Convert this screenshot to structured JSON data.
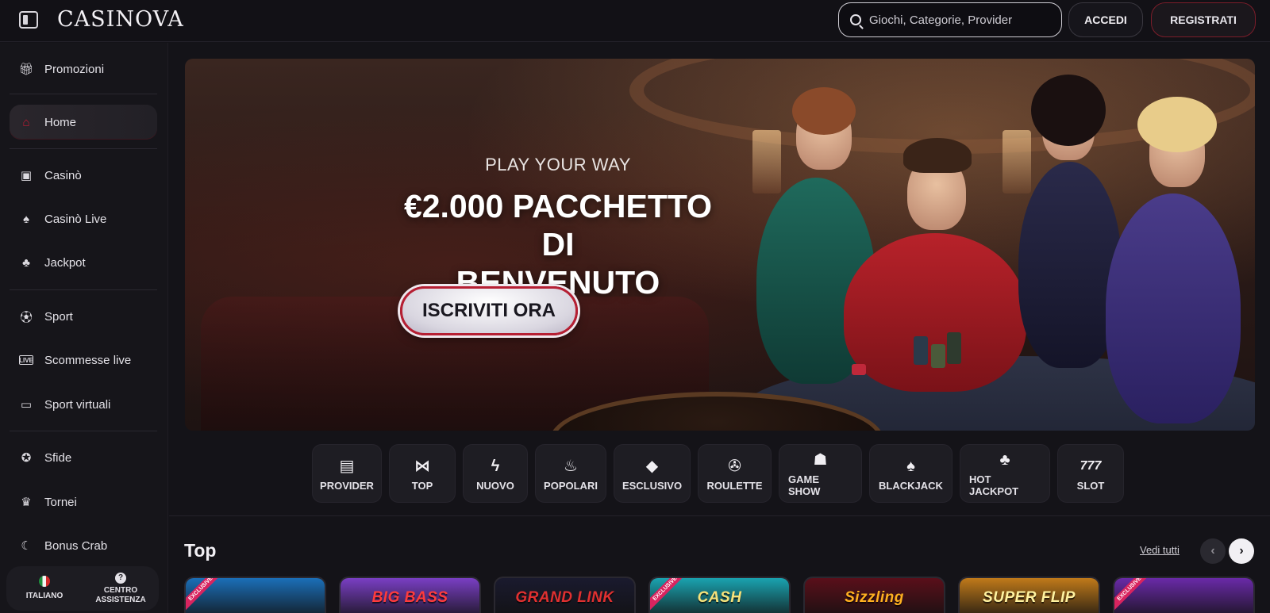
{
  "header": {
    "logo": "CASINOVA",
    "search_placeholder": "Giochi, Categorie, Provider",
    "login_label": "ACCEDI",
    "register_label": "REGISTRATI"
  },
  "sidebar": {
    "items": [
      {
        "label": "Promozioni",
        "icon": "gift-icon"
      },
      {
        "label": "Home",
        "icon": "home-icon",
        "active": true
      },
      {
        "label": "Casinò",
        "icon": "slot-machine-icon"
      },
      {
        "label": "Casinò Live",
        "icon": "live-cards-icon"
      },
      {
        "label": "Jackpot",
        "icon": "clover-icon"
      },
      {
        "label": "Sport",
        "icon": "soccer-ball-icon"
      },
      {
        "label": "Scommesse live",
        "icon": "live-badge-icon"
      },
      {
        "label": "Sport virtuali",
        "icon": "virtual-screen-icon"
      },
      {
        "label": "Sfide",
        "icon": "medal-icon"
      },
      {
        "label": "Tornei",
        "icon": "trophy-icon"
      },
      {
        "label": "Bonus Crab",
        "icon": "crab-claw-icon"
      }
    ],
    "footer": {
      "language_label": "ITALIANO",
      "help_label_line1": "CENTRO",
      "help_label_line2": "ASSISTENZA",
      "help_glyph": "?"
    }
  },
  "banner": {
    "subtitle": "PLAY YOUR WAY",
    "title_line1": "€2.000 PACCHETTO DI",
    "title_line2": "BENVENUTO",
    "cta_label": "ISCRIVITI ORA"
  },
  "categories": [
    {
      "label": "PROVIDER",
      "icon": "provider-book-icon",
      "glyph": "▤"
    },
    {
      "label": "TOP",
      "icon": "bow-tie-icon",
      "glyph": "⋈"
    },
    {
      "label": "NUOVO",
      "icon": "lightning-icon",
      "glyph": "ϟ"
    },
    {
      "label": "POPOLARI",
      "icon": "flame-icon",
      "glyph": "♨"
    },
    {
      "label": "ESCLUSIVO",
      "icon": "diamond-icon",
      "glyph": "◆"
    },
    {
      "label": "ROULETTE",
      "icon": "roulette-icon",
      "glyph": "✇"
    },
    {
      "label": "GAME SHOW",
      "icon": "mask-icon",
      "glyph": "☗"
    },
    {
      "label": "BLACKJACK",
      "icon": "cards-icon",
      "glyph": "♠"
    },
    {
      "label": "HOT JACKPOT",
      "icon": "hot-pepper-icon",
      "glyph": "♣"
    },
    {
      "label": "SLOT",
      "icon": "seven-icon",
      "glyph": "777"
    }
  ],
  "top_section": {
    "title": "Top",
    "see_all_label": "Vedi tutti",
    "prev_glyph": "‹",
    "next_glyph": "›",
    "games": [
      {
        "name": "",
        "bg": "#1b6fb8",
        "color": "#f6c83a",
        "exclusive": true
      },
      {
        "name": "BIG BASS",
        "bg": "#7a3fc4",
        "color": "#ff3b3b",
        "exclusive": false
      },
      {
        "name": "GRAND LINK",
        "bg": "#1a1a2e",
        "color": "#e03030",
        "exclusive": false
      },
      {
        "name": "CASH",
        "bg": "#1aa3b0",
        "color": "#f6e27a",
        "exclusive": true
      },
      {
        "name": "Sizzling",
        "bg": "#5a0f1a",
        "color": "#ffb020",
        "exclusive": false
      },
      {
        "name": "SUPER FLIP",
        "bg": "#c07a1a",
        "color": "#fff2a0",
        "exclusive": false
      },
      {
        "name": "",
        "bg": "#6a2aa8",
        "color": "#ffcf3a",
        "exclusive": true
      }
    ],
    "exclusive_label": "EXCLUSIVE"
  }
}
